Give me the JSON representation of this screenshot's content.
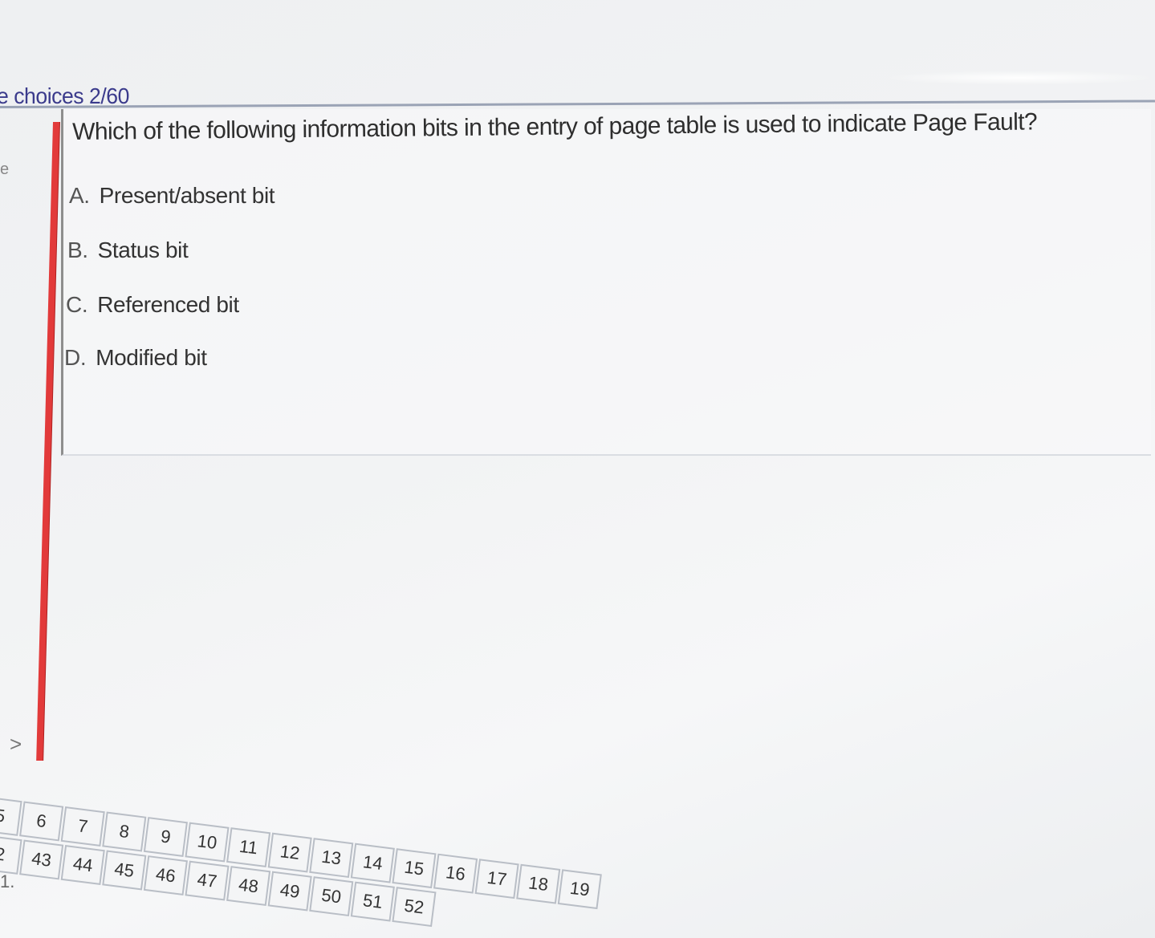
{
  "header": {
    "section_title": "e choices 2/60"
  },
  "sidebar": {
    "fragment_top": "e",
    "fragment_bottom": ">"
  },
  "question": {
    "text": "Which of the following information bits in the entry of page table is used to indicate Page Fault?",
    "options": [
      {
        "letter": "A.",
        "label": "Present/absent bit"
      },
      {
        "letter": "B.",
        "label": "Status bit"
      },
      {
        "letter": "C.",
        "label": "Referenced bit"
      },
      {
        "letter": "D.",
        "label": "Modified bit"
      }
    ]
  },
  "navigator": {
    "row1": [
      "5",
      "6",
      "7",
      "8",
      "9",
      "10",
      "11",
      "12",
      "13",
      "14",
      "15",
      "16",
      "17",
      "18",
      "19"
    ],
    "row2": [
      "2",
      "43",
      "44",
      "45",
      "46",
      "47",
      "48",
      "49",
      "50",
      "51",
      "52"
    ],
    "row3_fragment": "1."
  },
  "colors": {
    "accent_bar": "#e23a3a",
    "header_text": "#3b3b8c"
  }
}
